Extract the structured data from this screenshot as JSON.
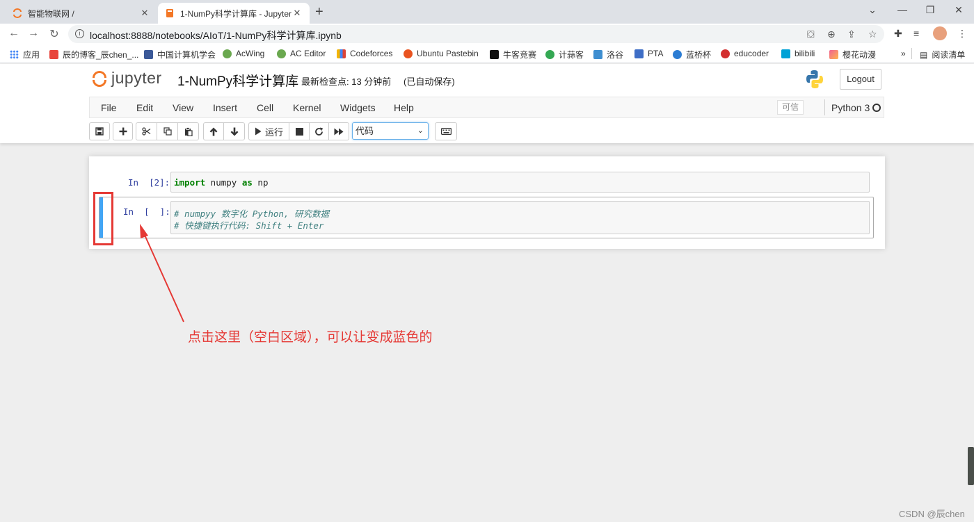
{
  "browser": {
    "tabs": [
      {
        "title": "智能物联网 /"
      },
      {
        "title": "1-NumPy科学计算库 - Jupyter"
      }
    ],
    "url": "localhost:8888/notebooks/AIoT/1-NumPy科学计算库.ipynb",
    "bookmarks": [
      {
        "label": "应用",
        "color": "#4285f4"
      },
      {
        "label": "辰的博客_辰chen_...",
        "color": "#e8453c"
      },
      {
        "label": "中国计算机学会",
        "color": "#3b5998"
      },
      {
        "label": "AcWing",
        "color": "#6aa84f"
      },
      {
        "label": "AC Editor",
        "color": "#6aa84f"
      },
      {
        "label": "Codeforces",
        "color": "#f4b400"
      },
      {
        "label": "Ubuntu Pastebin",
        "color": "#e95420"
      },
      {
        "label": "牛客竞赛",
        "color": "#111111"
      },
      {
        "label": "计蒜客",
        "color": "#34a853"
      },
      {
        "label": "洛谷",
        "color": "#3e8ed0"
      },
      {
        "label": "PTA",
        "color": "#3e6ec6"
      },
      {
        "label": "蓝桥杯",
        "color": "#2b7cd3"
      },
      {
        "label": "educoder",
        "color": "#d32f2f"
      },
      {
        "label": "bilibili",
        "color": "#00a1d6"
      },
      {
        "label": "樱花动漫",
        "color": "#f06292"
      }
    ],
    "more_bookmarks": "»",
    "reading_list": "阅读清单"
  },
  "jupyter": {
    "logo_text": "jupyter",
    "notebook_name": "1-NumPy科学计算库",
    "checkpoint": "最新检查点: 13 分钟前",
    "autosave": "(已自动保存)",
    "logout": "Logout",
    "menus": [
      "File",
      "Edit",
      "View",
      "Insert",
      "Cell",
      "Kernel",
      "Widgets",
      "Help"
    ],
    "trusted": "可信",
    "kernel": "Python 3",
    "toolbar": {
      "run_label": "运行",
      "cell_type": "代码"
    }
  },
  "cells": [
    {
      "prompt": "In  [2]:",
      "lines": [
        {
          "kw1": "import",
          "mid": " numpy ",
          "kw2": "as",
          "tail": " np"
        }
      ]
    },
    {
      "prompt": "In  [  ]:",
      "comment1": "# numpyy 数字化 Python, 研究数据",
      "comment2": "# 快捷键执行代码: Shift + Enter"
    }
  ],
  "annotation": {
    "text": "点击这里（空白区域），可以让变成蓝色的",
    "color": "#e53935"
  },
  "watermark": "CSDN @辰chen"
}
